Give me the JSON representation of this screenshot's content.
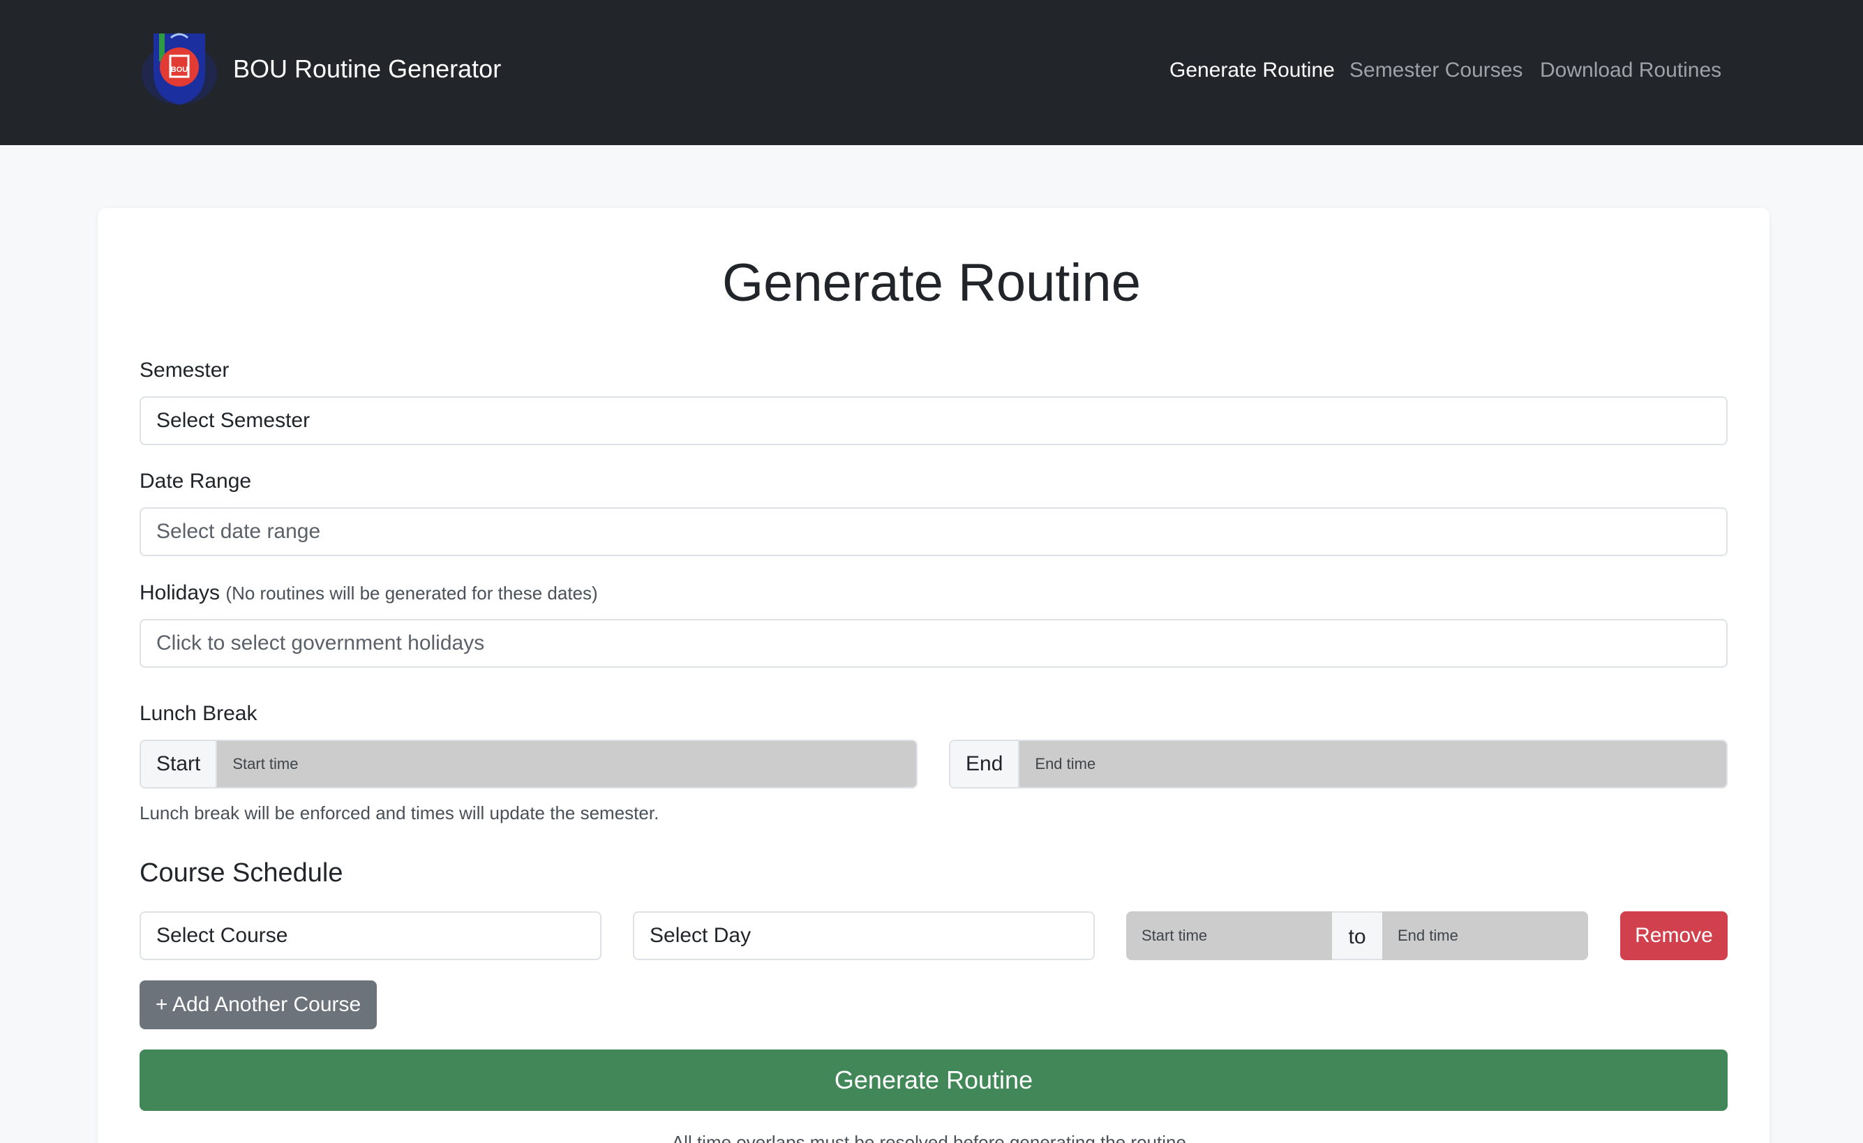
{
  "header": {
    "brand": "BOU Routine Generator",
    "logo_text": "BOU",
    "nav": [
      {
        "label": "Generate Routine",
        "active": true
      },
      {
        "label": "Semester Courses",
        "active": false
      },
      {
        "label": "Download Routines",
        "active": false
      }
    ]
  },
  "main": {
    "title": "Generate Routine",
    "semester": {
      "label": "Semester",
      "value": "Select Semester"
    },
    "date_range": {
      "label": "Date Range",
      "placeholder": "Select date range"
    },
    "holidays": {
      "label": "Holidays",
      "note": "(No routines will be generated for these dates)",
      "placeholder": "Click to select government holidays"
    },
    "lunch_break": {
      "label": "Lunch Break",
      "start_label": "Start",
      "start_placeholder": "Start time",
      "end_label": "End",
      "end_placeholder": "End time",
      "help": "Lunch break will be enforced and times will update the semester."
    },
    "course_schedule": {
      "title": "Course Schedule",
      "course_select": "Select Course",
      "day_select": "Select Day",
      "start_placeholder": "Start time",
      "to_label": "to",
      "end_placeholder": "End time",
      "remove_label": "Remove",
      "add_label": "+ Add Another Course"
    },
    "generate_label": "Generate Routine",
    "footer_note": "All time overlaps must be resolved before generating the routine."
  },
  "colors": {
    "navbar": "#22262b",
    "generate_button": "#428757",
    "remove_button": "#d0414d",
    "add_button": "#6c737a"
  }
}
